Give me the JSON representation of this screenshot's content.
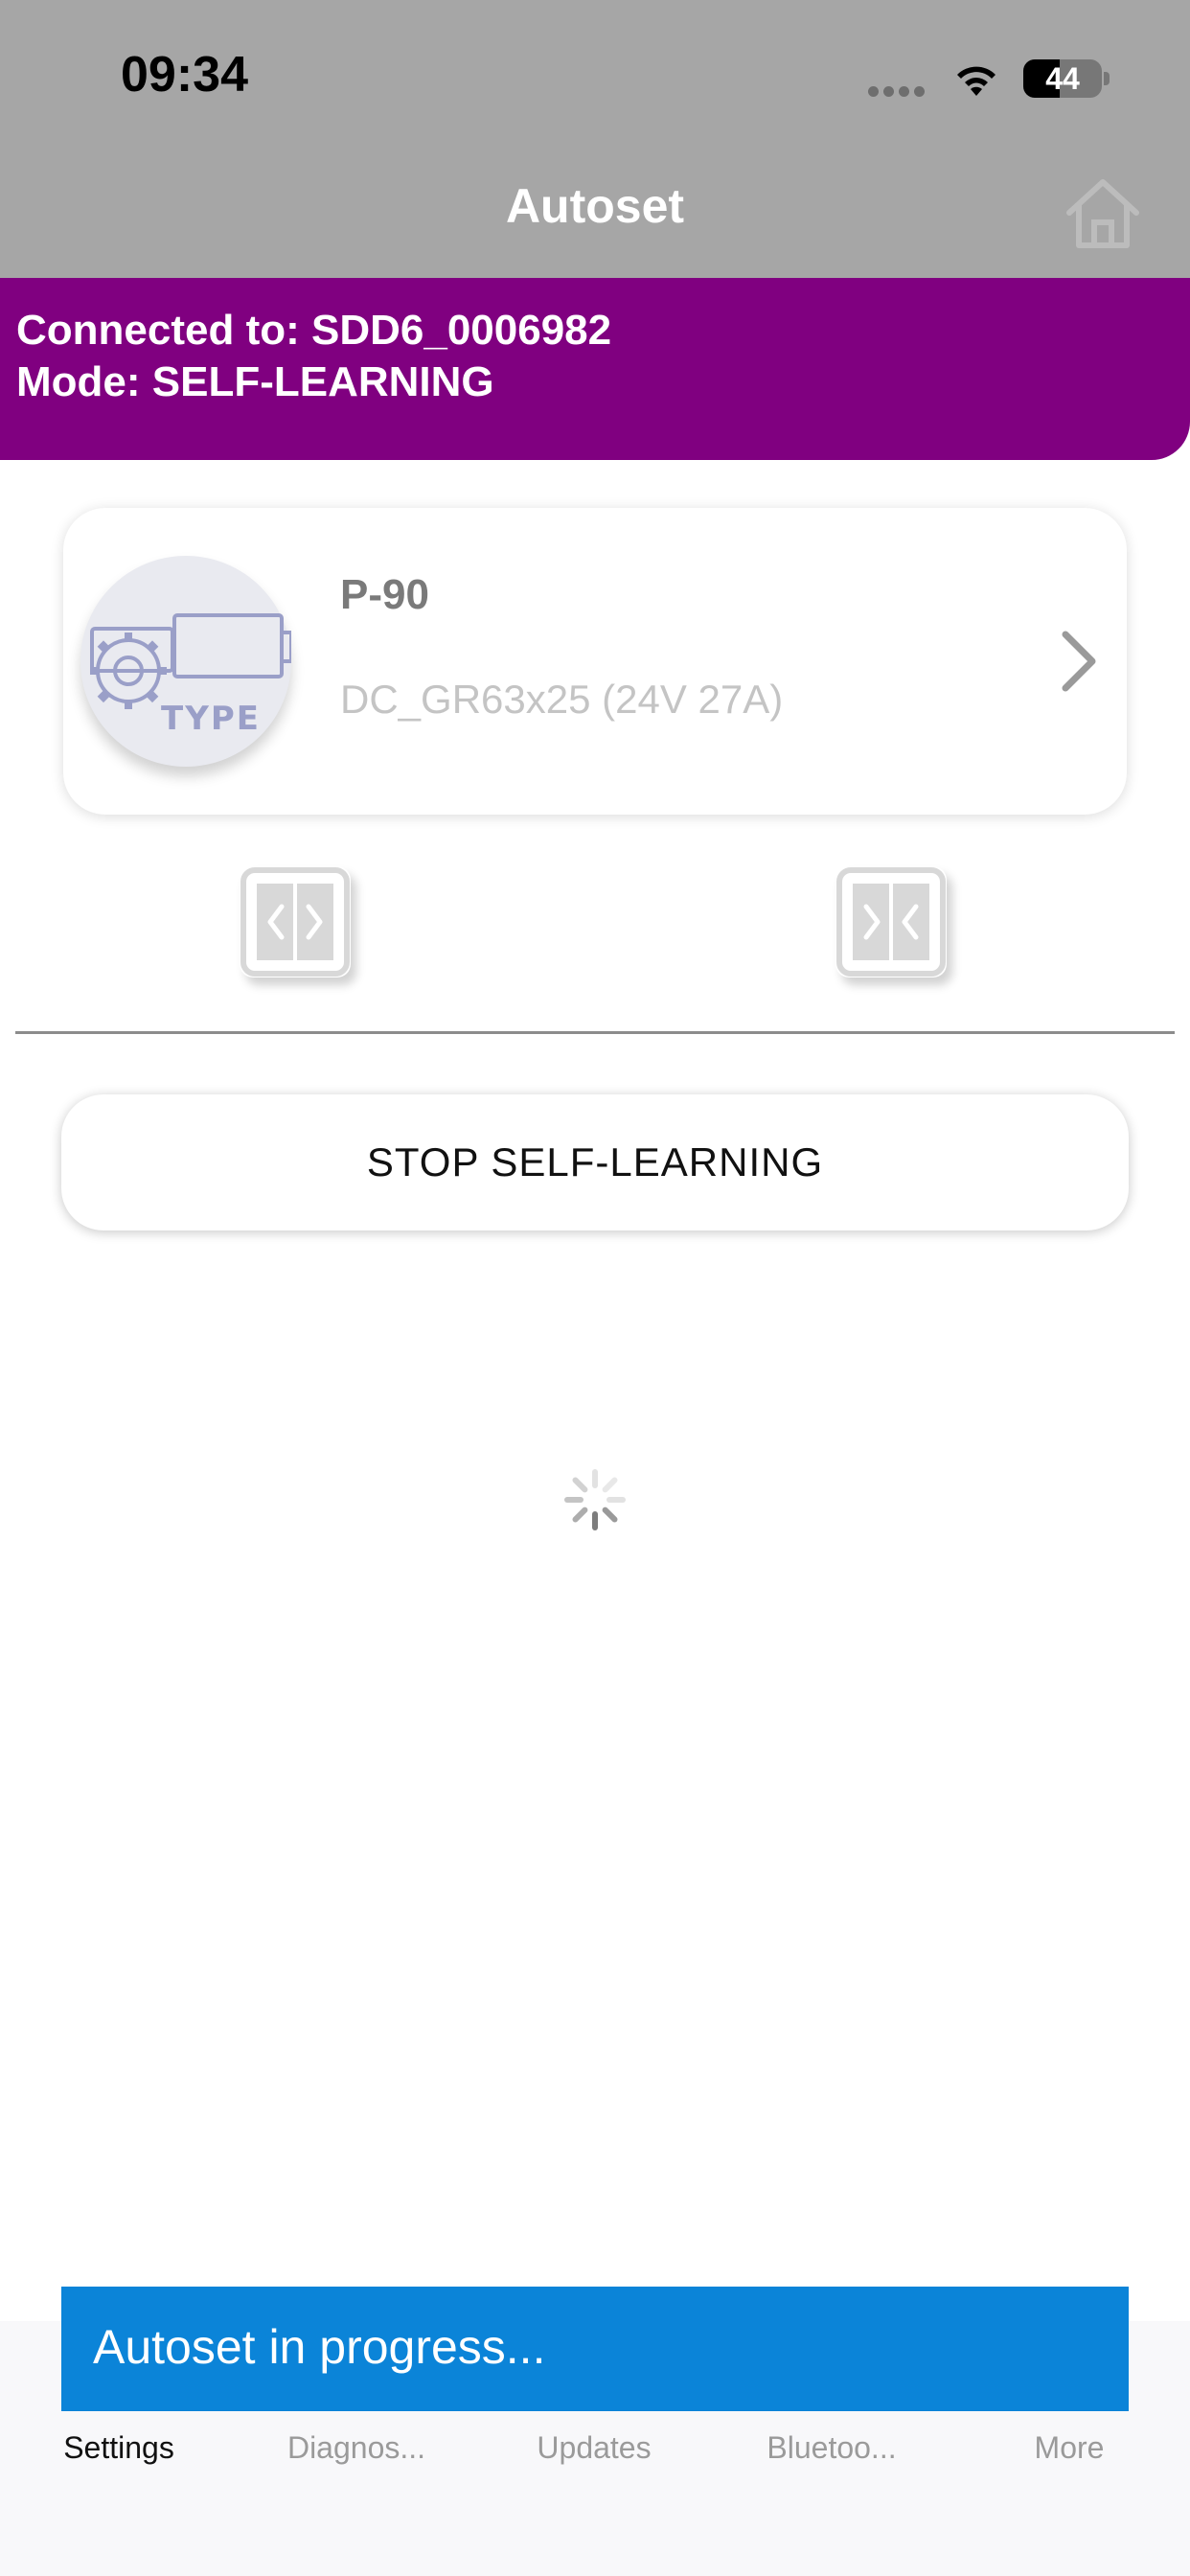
{
  "status_bar": {
    "time": "09:34",
    "battery": "44",
    "icons": [
      "cellular-signal-icon",
      "wifi-icon",
      "battery-icon"
    ]
  },
  "nav": {
    "title": "Autoset",
    "home_icon": "home-icon"
  },
  "connection": {
    "connected_line": "Connected to: SDD6_0006982",
    "mode_line": "Mode: SELF-LEARNING",
    "banner_color": "#800080"
  },
  "motor": {
    "badge_label": "TYPE",
    "name": "P-90",
    "spec": "DC_GR63x25 (24V 27A)",
    "chevron_icon": "chevron-right-icon"
  },
  "door_buttons": [
    {
      "icon": "door-open-icon"
    },
    {
      "icon": "door-close-icon"
    }
  ],
  "actions": {
    "stop_label": "STOP SELF-LEARNING"
  },
  "loading": {
    "icon": "activity-spinner-icon"
  },
  "toast": {
    "message": "Autoset in progress...",
    "color": "#0b84d8"
  },
  "tabs": [
    {
      "label": "Settings",
      "active": true
    },
    {
      "label": "Diagnos...",
      "active": false
    },
    {
      "label": "Updates",
      "active": false
    },
    {
      "label": "Bluetoo...",
      "active": false
    },
    {
      "label": "More",
      "active": false
    }
  ]
}
